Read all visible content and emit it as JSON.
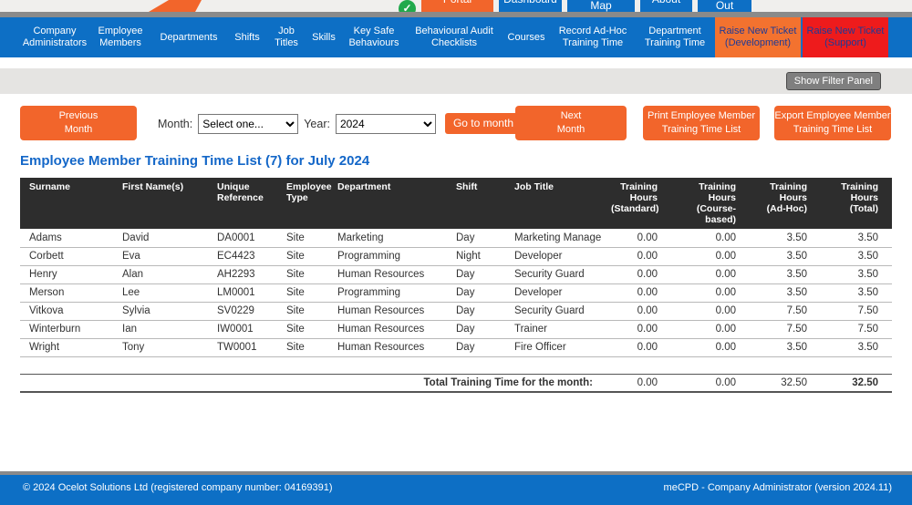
{
  "topbar": {
    "buttons": [
      {
        "id": "portal",
        "label": "Portal"
      },
      {
        "id": "dashboard",
        "label": "Dashboard"
      },
      {
        "id": "entity-map",
        "label": "Entity Map"
      },
      {
        "id": "about",
        "label": "About"
      },
      {
        "id": "log-out",
        "label": "Log Out"
      }
    ]
  },
  "nav": {
    "items": [
      {
        "id": "company-administrators",
        "label": "Company Administrators"
      },
      {
        "id": "employee-members",
        "label": "Employee Members"
      },
      {
        "id": "departments",
        "label": "Departments"
      },
      {
        "id": "shifts",
        "label": "Shifts"
      },
      {
        "id": "job-titles",
        "label": "Job Titles"
      },
      {
        "id": "skills",
        "label": "Skills"
      },
      {
        "id": "key-safe-behaviours",
        "label": "Key Safe Behaviours"
      },
      {
        "id": "behavioural-audit-checklists",
        "label": "Behavioural Audit Checklists"
      },
      {
        "id": "courses",
        "label": "Courses"
      },
      {
        "id": "record-ad-hoc-training-time",
        "label": "Record Ad-Hoc Training Time"
      },
      {
        "id": "department-training-time",
        "label": "Department Training Time"
      },
      {
        "id": "raise-new-ticket-development",
        "label": "Raise New Ticket (Development)",
        "style": "ticket-dev"
      },
      {
        "id": "raise-new-ticket-support",
        "label": "Raise New Ticket (Support)",
        "style": "ticket-support"
      }
    ]
  },
  "filter_bar": {
    "show_filter_panel": "Show Filter Panel"
  },
  "controls": {
    "previous_month": {
      "line1": "Previous",
      "line2": "Month"
    },
    "month_label": "Month:",
    "month_selected": "Select one...",
    "year_label": "Year:",
    "year_selected": "2024",
    "go_to_month": "Go to month",
    "next_month": {
      "line1": "Next",
      "line2": "Month"
    },
    "print_list": {
      "line1": "Print Employee Member",
      "line2": "Training Time List"
    },
    "export_list": {
      "line1": "Export Employee Member",
      "line2": "Training Time List"
    }
  },
  "page_title": "Employee Member Training Time List (7) for July 2024",
  "table": {
    "column_keys": [
      "surname",
      "first-names",
      "unique-reference",
      "employee-type",
      "department",
      "shift",
      "job-title",
      "training-hours-standard",
      "training-hours-course-based",
      "training-hours-ad-hoc",
      "training-hours-total"
    ],
    "headers": [
      [
        "Surname"
      ],
      [
        "First Name(s)"
      ],
      [
        "Unique",
        "Reference"
      ],
      [
        "Employee",
        "Type"
      ],
      [
        "Department"
      ],
      [
        "Shift"
      ],
      [
        "Job Title"
      ],
      [
        "Training Hours",
        "(Standard)"
      ],
      [
        "Training Hours",
        "(Course-based)"
      ],
      [
        "Training Hours",
        "(Ad-Hoc)"
      ],
      [
        "Training Hours",
        "(Total)"
      ]
    ],
    "rows": [
      [
        "Adams",
        "David",
        "DA0001",
        "Site",
        "Marketing",
        "Day",
        "Marketing Manager",
        "0.00",
        "0.00",
        "3.50",
        "3.50"
      ],
      [
        "Corbett",
        "Eva",
        "EC4423",
        "Site",
        "Programming",
        "Night",
        "Developer",
        "0.00",
        "0.00",
        "3.50",
        "3.50"
      ],
      [
        "Henry",
        "Alan",
        "AH2293",
        "Site",
        "Human Resources",
        "Day",
        "Security Guard",
        "0.00",
        "0.00",
        "3.50",
        "3.50"
      ],
      [
        "Merson",
        "Lee",
        "LM0001",
        "Site",
        "Programming",
        "Day",
        "Developer",
        "0.00",
        "0.00",
        "3.50",
        "3.50"
      ],
      [
        "Vitkova",
        "Sylvia",
        "SV0229",
        "Site",
        "Human Resources",
        "Day",
        "Security Guard",
        "0.00",
        "0.00",
        "7.50",
        "7.50"
      ],
      [
        "Winterburn",
        "Ian",
        "IW0001",
        "Site",
        "Human Resources",
        "Day",
        "Trainer",
        "0.00",
        "0.00",
        "7.50",
        "7.50"
      ],
      [
        "Wright",
        "Tony",
        "TW0001",
        "Site",
        "Human Resources",
        "Day",
        "Fire Officer",
        "0.00",
        "0.00",
        "3.50",
        "3.50"
      ]
    ],
    "total_row": {
      "label": "Total Training Time for the month:",
      "standard": "0.00",
      "course_based": "0.00",
      "ad_hoc": "32.50",
      "total": "32.50"
    }
  },
  "footer": {
    "left": "© 2024 Ocelot Solutions Ltd (registered company number: 04169391)",
    "right": "meCPD - Company Administrator (version 2024.11)"
  },
  "colors": {
    "nav_blue": "#0d6fc5",
    "orange": "#f2652b",
    "ticket_orange": "#f3722f",
    "ticket_red": "#ee1b1c",
    "ticket_text_blue": "#1e3a96",
    "table_header_dark": "#2d2d2d",
    "title_blue": "#1467c8",
    "check_green": "#21a94c"
  }
}
